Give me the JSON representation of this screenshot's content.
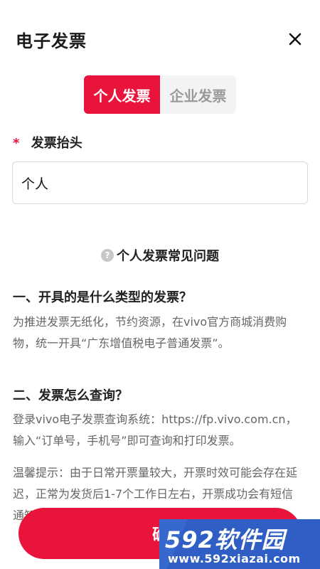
{
  "header": {
    "title": "电子发票"
  },
  "tabs": {
    "personal": "个人发票",
    "company": "企业发票"
  },
  "form": {
    "required_mark": "*",
    "invoice_title_label": "发票抬头",
    "invoice_title_value": "个人"
  },
  "faq": {
    "title": "个人发票常见问题",
    "q1": "一、开具的是什么类型的发票？",
    "a1": "为推进发票无纸化，节约资源，在vivo官方商城消费购物，统一开具“广东增值税电子普通发票”。",
    "q2": "二、发票怎么查询？",
    "a2": "登录vivo电子发票查询系统：https://fp.vivo.com.cn，输入“订单号，手机号”即可查询和打印发票。",
    "tip": "温馨提示：由于日常开票量较大，开票时效可能会存在延迟，正常为发货后1-7个工作日左右，开票成功会有短信通知，还请"
  },
  "actions": {
    "confirm_visible": "确"
  },
  "watermark": {
    "main": "592软件园",
    "sub": "www.592xiazai.com"
  },
  "colors": {
    "accent": "#e8143c",
    "watermark": "#2f5fc5"
  },
  "icons": {
    "close": "close-icon",
    "help": "help-icon"
  }
}
